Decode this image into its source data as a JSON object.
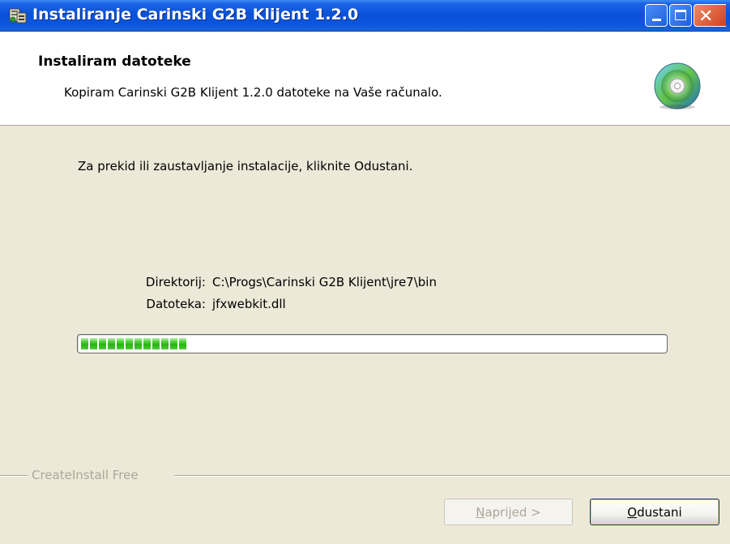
{
  "window": {
    "title": "Instaliranje Carinski G2B Klijent 1.2.0",
    "controls": {
      "minimize": "minimize",
      "maximize": "maximize",
      "close": "close"
    }
  },
  "header": {
    "title": "Instaliram datoteke",
    "subtitle": "Kopiram Carinski G2B Klijent 1.2.0 datoteke na Vaše računalo.",
    "icon": "cd-install-icon"
  },
  "main": {
    "instruction": "Za prekid ili zaustavljanje instalacije, kliknite Odustani.",
    "directory_label": "Direktorij:",
    "directory_value": "C:\\Progs\\Carinski G2B Klijent\\jre7\\bin",
    "file_label": "Datoteka:",
    "file_value": "jfxwebkit.dll",
    "progress": {
      "percent": 19,
      "color": "#28b411"
    }
  },
  "footer": {
    "brand": "CreateInstall Free",
    "next_label_mnemonic": "N",
    "next_label_rest": "aprijed >",
    "cancel_label_mnemonic": "O",
    "cancel_label_rest": "dustani"
  },
  "colors": {
    "titlebar": "#0a52d8",
    "dialog_bg": "#ece9d8",
    "header_bg": "#ffffff",
    "disabled_text": "#a9a898"
  }
}
